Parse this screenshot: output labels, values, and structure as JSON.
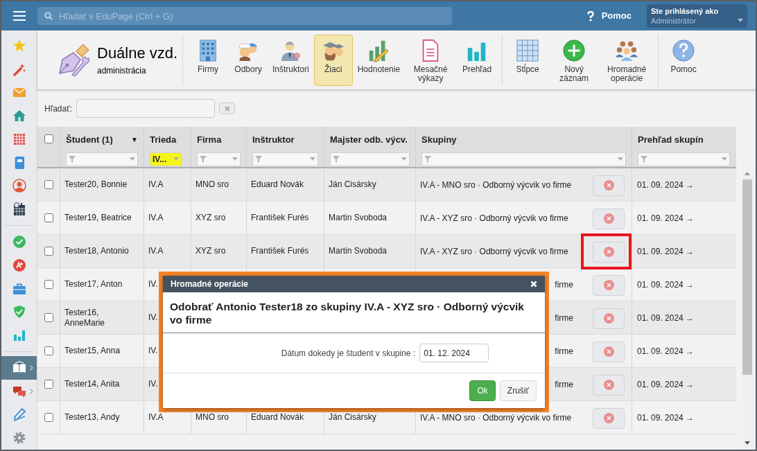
{
  "topbar": {
    "search_placeholder": "Hľadať v EduPage (Ctrl + G)",
    "help_label": "Pomoc",
    "user": {
      "caption": "Ste prihlásený ako",
      "name": "Administrátor"
    }
  },
  "sidebar": {
    "groups": [
      [
        {
          "kind": "star",
          "selected": false,
          "expandable": false
        },
        {
          "kind": "wand",
          "selected": false,
          "expandable": false
        },
        {
          "kind": "mail",
          "selected": false,
          "expandable": false
        },
        {
          "kind": "home",
          "selected": false,
          "expandable": false
        },
        {
          "kind": "calendar",
          "selected": false,
          "expandable": false
        },
        {
          "kind": "notebook",
          "selected": false,
          "expandable": false
        },
        {
          "kind": "person",
          "selected": false,
          "expandable": false
        },
        {
          "kind": "schedule",
          "selected": false,
          "expandable": false
        }
      ],
      [
        {
          "kind": "check",
          "selected": false,
          "expandable": false
        },
        {
          "kind": "grade",
          "selected": false,
          "expandable": false
        },
        {
          "kind": "briefcase",
          "selected": false,
          "expandable": false
        },
        {
          "kind": "shield",
          "selected": false,
          "expandable": false
        },
        {
          "kind": "chart",
          "selected": false,
          "expandable": false
        }
      ],
      [
        {
          "kind": "book",
          "selected": true,
          "expandable": true
        },
        {
          "kind": "chat",
          "selected": false,
          "expandable": true
        },
        {
          "kind": "pen",
          "selected": false,
          "expandable": false
        },
        {
          "kind": "gear",
          "selected": false,
          "expandable": false
        }
      ]
    ]
  },
  "module": {
    "title": "Duálne vzd.",
    "subtitle": "administrácia"
  },
  "toolbar": {
    "groups": [
      [
        {
          "label": "Firmy",
          "kind": "building",
          "selected": false
        },
        {
          "label": "Odbory",
          "kind": "workers",
          "selected": false
        },
        {
          "label": "Inštruktori",
          "kind": "instructor",
          "selected": false
        },
        {
          "label": "Žiaci",
          "kind": "students",
          "selected": true
        },
        {
          "label": "Hodnotenie",
          "kind": "grading",
          "selected": false
        },
        {
          "label": "Mesačné výkazy",
          "kind": "document",
          "selected": false
        },
        {
          "label": "Prehľad",
          "kind": "barchart",
          "selected": false
        }
      ],
      [
        {
          "label": "Stĺpce",
          "kind": "columns",
          "selected": false
        },
        {
          "label": "Nový záznam",
          "kind": "plus",
          "selected": false
        },
        {
          "label": "Hromadné operácie",
          "kind": "group",
          "selected": false
        }
      ],
      [
        {
          "label": "Pomoc",
          "kind": "help",
          "selected": false
        }
      ]
    ]
  },
  "search": {
    "label": "Hľadať:"
  },
  "table": {
    "select_all_checked": false,
    "columns": [
      {
        "label": "Študent (1)",
        "sort_indicator": "▼",
        "filter": {
          "active": false
        }
      },
      {
        "label": "Trieda",
        "filter": {
          "value": "IV...",
          "active": true
        }
      },
      {
        "label": "Firma",
        "filter": {
          "active": false
        }
      },
      {
        "label": "Inštruktor",
        "filter": {
          "active": false
        }
      },
      {
        "label": "Majster odb. výcv.",
        "filter": {
          "active": false
        }
      },
      {
        "label": "Skupiny",
        "filter": {
          "active": false
        }
      },
      {
        "label": "Prehľad skupín",
        "filter": {
          "active": false
        }
      }
    ],
    "rows": [
      {
        "checked": false,
        "highlighted": false,
        "student": "Tester20, Bonnie",
        "trieda": "IV.A",
        "firma": "MNO sro",
        "instruktor": "Eduard Novák",
        "majster": "Ján Cisársky",
        "skupina": "IV.A - MNO sro · Odborný výcvik vo firme",
        "prehlad": "01. 09. 2024 →"
      },
      {
        "checked": false,
        "highlighted": false,
        "student": "Tester19, Beatrice",
        "trieda": "IV.A",
        "firma": "XYZ sro",
        "instruktor": "František Furés",
        "majster": "Martin Svoboda",
        "skupina": "IV.A - XYZ sro · Odborný výcvik vo firme",
        "prehlad": "01. 09. 2024 →"
      },
      {
        "checked": false,
        "highlighted": true,
        "student": "Tester18, Antonio",
        "trieda": "IV.A",
        "firma": "XYZ sro",
        "instruktor": "František Furés",
        "majster": "Martin Svoboda",
        "skupina": "IV.A - XYZ sro · Odborný výcvik vo firme",
        "prehlad": "01. 09. 2024 →"
      },
      {
        "checked": false,
        "highlighted": false,
        "student": "Tester17, Anton",
        "trieda": "IV.",
        "skupina_tail": "firme",
        "prehlad": "01. 09. 2024 →"
      },
      {
        "checked": false,
        "highlighted": false,
        "student": "Tester16, AnneMarie",
        "trieda": "IV.",
        "skupina_tail": "firme",
        "prehlad": "01. 09. 2024 →"
      },
      {
        "checked": false,
        "highlighted": false,
        "student": "Tester15, Anna",
        "trieda": "IV.",
        "skupina_tail": "firme",
        "prehlad": "01. 09. 2024 →"
      },
      {
        "checked": false,
        "highlighted": false,
        "student": "Tester14, Anita",
        "trieda": "IV.",
        "skupina_tail": "firme",
        "prehlad": "01. 09. 2024 →"
      },
      {
        "checked": false,
        "highlighted": false,
        "student": "Tester13, Andy",
        "trieda": "IV.A",
        "firma": "MNO sro",
        "instruktor": "Eduard Novák",
        "majster": "Ján Cisársky",
        "skupina": "IV.A - MNO sro · Odborný výcvik vo firme",
        "prehlad": "01. 09. 2024 →"
      }
    ]
  },
  "dialog": {
    "title": "Hromadné operácie",
    "heading": "Odobrať Antonio Tester18 zo skupiny IV.A - XYZ sro · Odborný výcvik vo firme",
    "field_label": "Dátum dokedy je študent v skupine :",
    "field_value": "01. 12. 2024",
    "buttons": [
      {
        "label": "Ok",
        "kind": "primary"
      },
      {
        "label": "Zrušiť",
        "kind": "secondary"
      }
    ]
  }
}
